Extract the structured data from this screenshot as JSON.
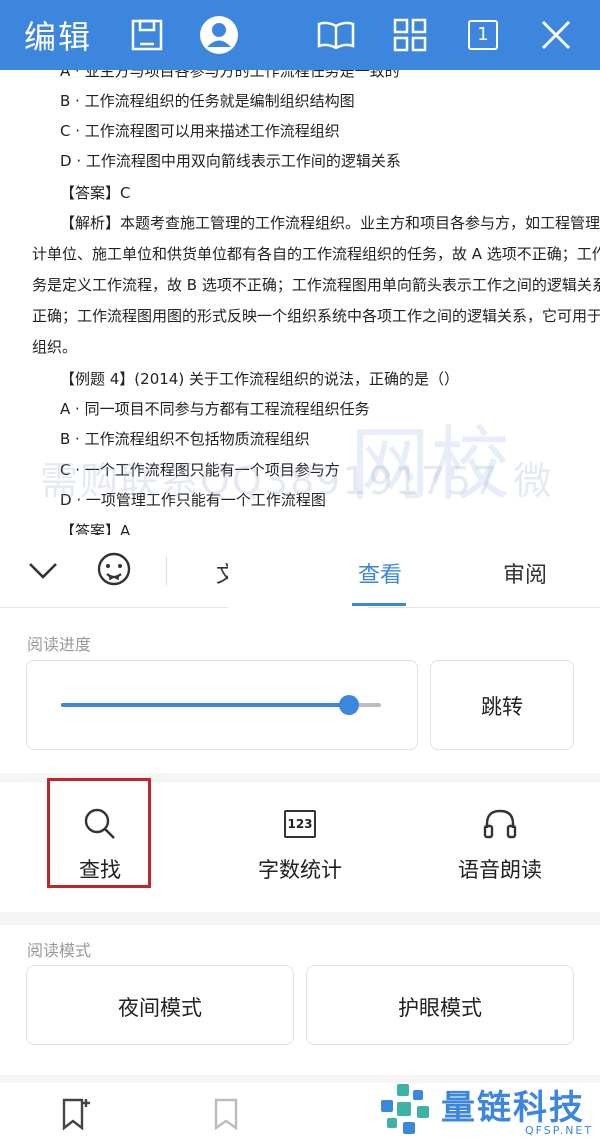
{
  "toolbar": {
    "title": "编辑",
    "page_count": "1",
    "icons": [
      "save-icon",
      "account-icon",
      "book-icon",
      "grid-icon",
      "page-count-icon",
      "close-icon"
    ]
  },
  "document": {
    "lines": [
      "A · 业主方与项目各参与方的工作流程任务是一致的",
      "B · 工作流程组织的任务就是编制组织结构图",
      "C · 工作流程图可以用来描述工作流程组织",
      "D · 工作流程图中用双向箭线表示工作间的逻辑关系",
      "【答案】C",
      "【解析】本题考查施工管理的工作流程组织。业主方和项目各参与方，如工程管理咨询",
      "计单位、施工单位和供货单位都有各自的工作流程组织的任务，故 A 选项不正确；工作流",
      "务是定义工作流程，故 B 选项不正确；工作流程图用单向箭头表示工作之间的逻辑关系，",
      "正确；工作流程图用图的形式反映一个组织系统中各项工作之间的逻辑关系，它可用于描述",
      "组织。",
      "【例题 4】(2014) 关于工作流程组织的说法，正确的是（）",
      "A · 同一项目不同参与方都有工程流程组织任务",
      "B · 工作流程组织不包括物质流程组织",
      "C · 一个工作流程图只能有一个项目参与方",
      "D · 一项管理工作只能有一个工作流程图",
      "【答案】A"
    ],
    "watermark": "需购联系QQ389191757 微",
    "watermark_big": "网校"
  },
  "tabs": {
    "partial_label": "文",
    "view_label": "查看",
    "review_label": "审阅"
  },
  "reading_progress": {
    "label": "阅读进度",
    "value": 0.9,
    "jump_label": "跳转"
  },
  "features": {
    "find_label": "查找",
    "word_count_label": "字数统计",
    "read_aloud_label": "语音朗读",
    "word_count_icon_text": "123"
  },
  "reading_mode": {
    "label": "阅读模式",
    "night_label": "夜间模式",
    "eye_label": "护眼模式"
  },
  "branding": {
    "name": "量链科技",
    "url": "QFSP.NET"
  },
  "colors": {
    "accent": "#3d86de",
    "highlight": "#c0262a"
  }
}
